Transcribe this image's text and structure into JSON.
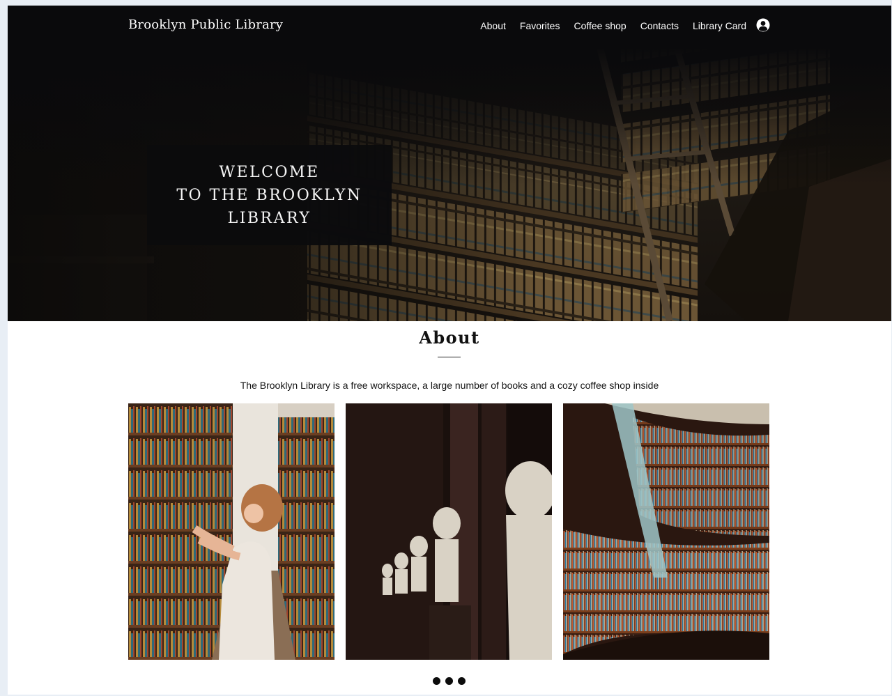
{
  "header": {
    "brand": "Brooklyn Public Library",
    "nav": [
      "About",
      "Favorites",
      "Coffee shop",
      "Contacts",
      "Library Card"
    ],
    "profile_icon": "user-circle-icon"
  },
  "hero": {
    "welcome": "WELCOME\nTO THE BROOKLYN\nLIBRARY"
  },
  "about": {
    "title": "About",
    "description": "The Brooklyn Library is a free workspace, a large number of books and a cozy coffee shop inside",
    "photos": [
      "woman-browsing-shelves-photo",
      "marble-busts-hall-photo",
      "curved-bookshelves-photo"
    ],
    "carousel_dots": 3
  }
}
